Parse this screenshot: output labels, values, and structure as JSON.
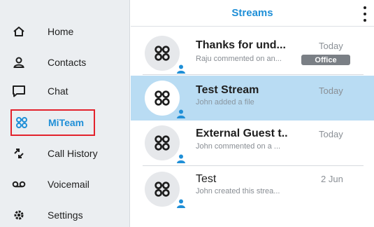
{
  "sidebar": {
    "items": [
      {
        "label": "Home",
        "icon": "home-icon"
      },
      {
        "label": "Contacts",
        "icon": "person-icon"
      },
      {
        "label": "Chat",
        "icon": "chat-bubble-icon"
      },
      {
        "label": "MiTeam",
        "icon": "miteam-icon",
        "active": true
      },
      {
        "label": "Call History",
        "icon": "call-history-icon"
      },
      {
        "label": "Voicemail",
        "icon": "voicemail-icon"
      },
      {
        "label": "Settings",
        "icon": "gear-icon"
      }
    ]
  },
  "header": {
    "title": "Streams",
    "menu_icon": "kebab-menu-icon"
  },
  "streams": [
    {
      "name": "Thanks for und...",
      "preview": "Raju commented on an...",
      "date": "Today",
      "tag": "Office",
      "selected": false
    },
    {
      "name": "Test Stream",
      "preview": "John added a file",
      "date": "Today",
      "selected": true
    },
    {
      "name": "External Guest t..",
      "preview": "John commented on a ...",
      "date": "Today",
      "selected": false
    },
    {
      "name": "Test",
      "preview": "John created this strea...",
      "date": "2 Jun",
      "selected": false
    }
  ],
  "colors": {
    "accent": "#1f8fd7",
    "selected_row": "#b9dcf3",
    "active_outline": "#e3222c",
    "sidebar_bg": "#ebeef1",
    "tag_bg": "#7a7f85"
  }
}
